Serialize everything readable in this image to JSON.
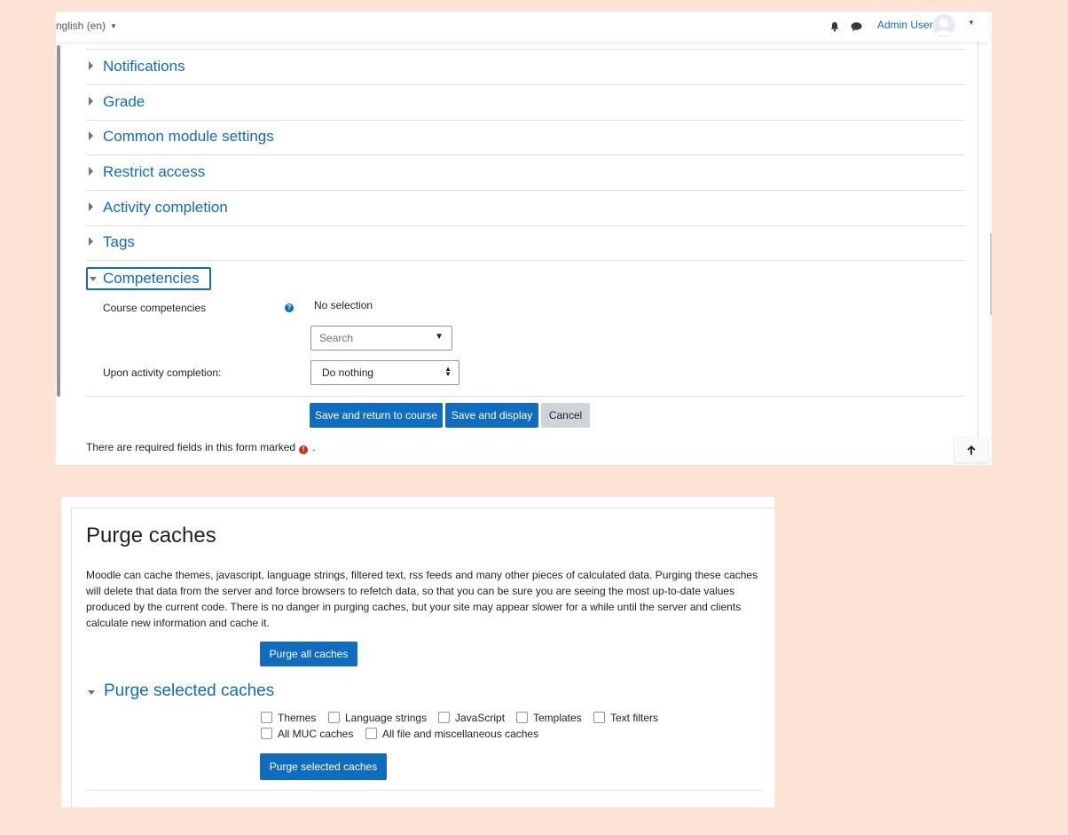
{
  "navbar": {
    "language": "nglish (en)",
    "user_name": "Admin User",
    "notification_icon": "bell-icon",
    "messages_icon": "chat-bubble-icon"
  },
  "form": {
    "sections": [
      {
        "label": "Notifications",
        "expanded": false
      },
      {
        "label": "Grade",
        "expanded": false
      },
      {
        "label": "Common module settings",
        "expanded": false
      },
      {
        "label": "Restrict access",
        "expanded": false
      },
      {
        "label": "Activity completion",
        "expanded": false
      },
      {
        "label": "Tags",
        "expanded": false
      }
    ],
    "competencies": {
      "title": "Competencies",
      "course_competencies_label": "Course competencies",
      "no_selection": "No selection",
      "search_placeholder": "Search",
      "upon_completion_label": "Upon activity completion:",
      "upon_completion_value": "Do nothing"
    },
    "buttons": {
      "save_return": "Save and return to course",
      "save_display": "Save and display",
      "cancel": "Cancel"
    },
    "required_note": "There are required fields in this form marked",
    "required_period": "."
  },
  "purge": {
    "title": "Purge caches",
    "description": "Moodle can cache themes, javascript, language strings, filtered text, rss feeds and many other pieces of calculated data. Purging these caches will delete that data from the server and force browsers to refetch data, so that you can be sure you are seeing the most up-to-date values produced by the current code. There is no danger in purging caches, but your site may appear slower for a while until the server and clients calculate new information and cache it.",
    "purge_all_button": "Purge all caches",
    "selected_section_title": "Purge selected caches",
    "checkboxes": [
      {
        "label": "Themes",
        "checked": false
      },
      {
        "label": "Language strings",
        "checked": false
      },
      {
        "label": "JavaScript",
        "checked": false
      },
      {
        "label": "Templates",
        "checked": false
      },
      {
        "label": "Text filters",
        "checked": false
      },
      {
        "label": "All MUC caches",
        "checked": false
      },
      {
        "label": "All file and miscellaneous caches",
        "checked": false
      }
    ],
    "purge_selected_button": "Purge selected caches"
  },
  "colors": {
    "primary": "#0f6cbf",
    "background": "#fde3d6",
    "danger": "#ca3120",
    "secondary_button": "#ced4da"
  }
}
